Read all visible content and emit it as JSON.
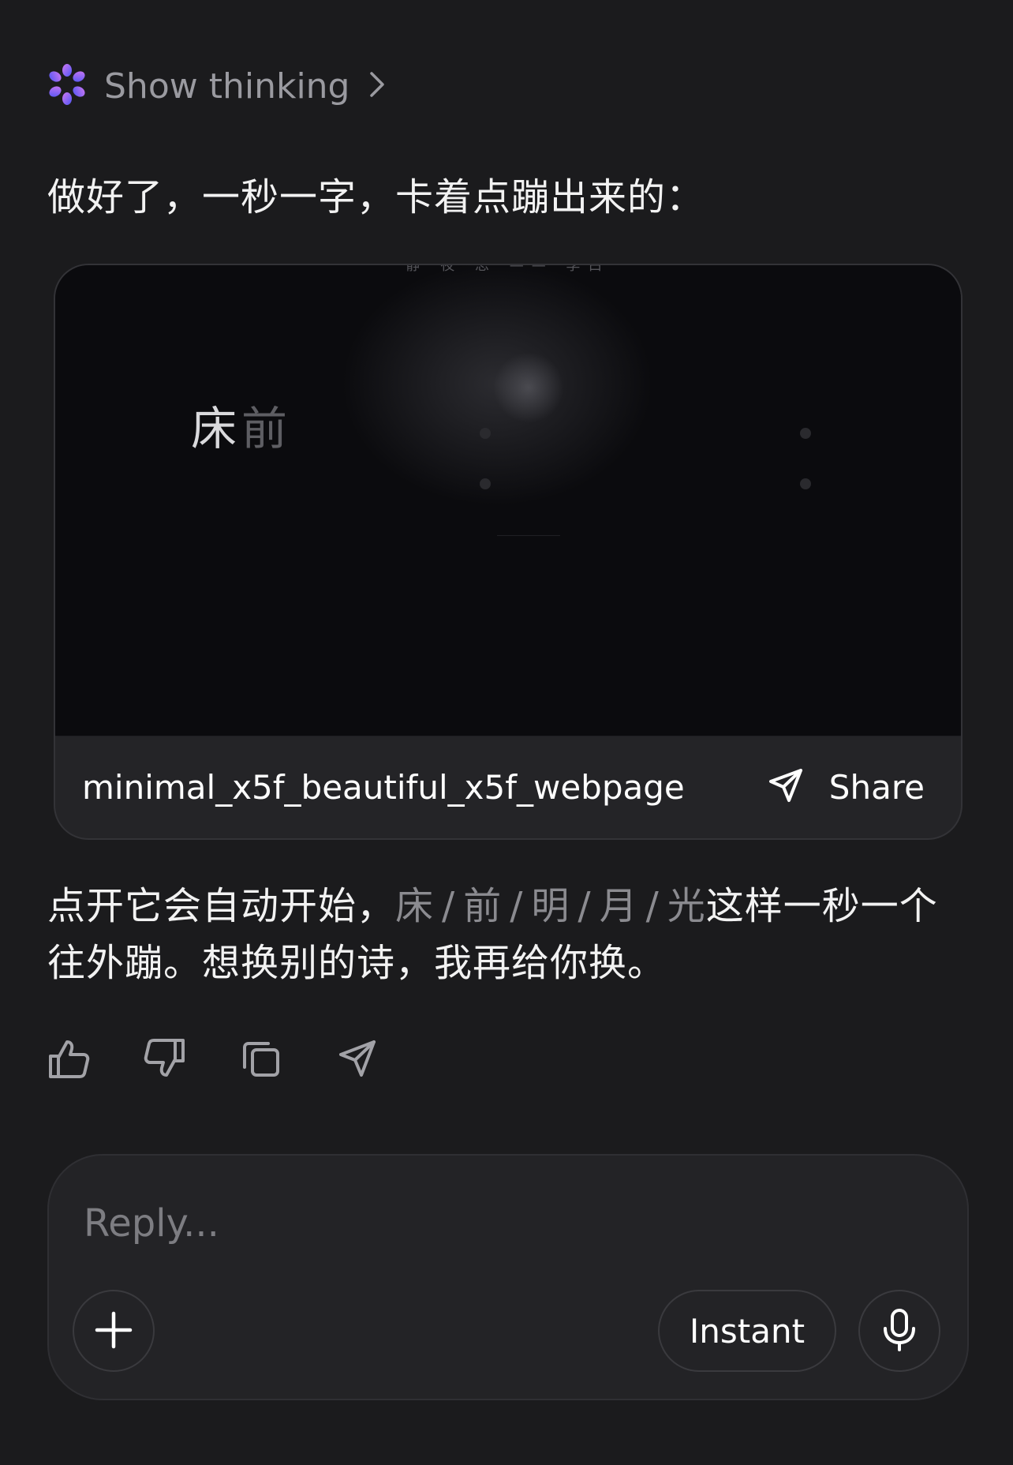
{
  "thinking": {
    "label": "Show thinking",
    "logo_icon": "flower-logo-icon",
    "chevron_icon": "chevron-right-icon"
  },
  "message": {
    "intro": "做好了，一秒一字，卡着点蹦出来的：",
    "body_prefix": "点开它会自动开始，",
    "poem_chars": [
      "床",
      "前",
      "明",
      "月",
      "光"
    ],
    "poem_separator": "/",
    "body_suffix": "这样一秒一个往外蹦。想换别的诗，我再给你换。"
  },
  "artifact": {
    "preview_header": "静 夜 思 —— 李白",
    "preview_chars_shown": "床",
    "preview_chars_fading": "前",
    "filename": "minimal_x5f_beautiful_x5f_webpage",
    "share_label": "Share",
    "share_icon": "send-icon"
  },
  "actions": [
    {
      "name": "thumbs-up-icon"
    },
    {
      "name": "thumbs-down-icon"
    },
    {
      "name": "copy-icon"
    },
    {
      "name": "share-icon"
    }
  ],
  "composer": {
    "placeholder": "Reply...",
    "mode_label": "Instant",
    "plus_icon": "plus-icon",
    "mic_icon": "microphone-icon"
  },
  "colors": {
    "background": "#1b1b1d",
    "card": "#242427",
    "muted_text": "#8b8b90",
    "logo_gradient": [
      "#c36cf0",
      "#5b5df5"
    ]
  }
}
